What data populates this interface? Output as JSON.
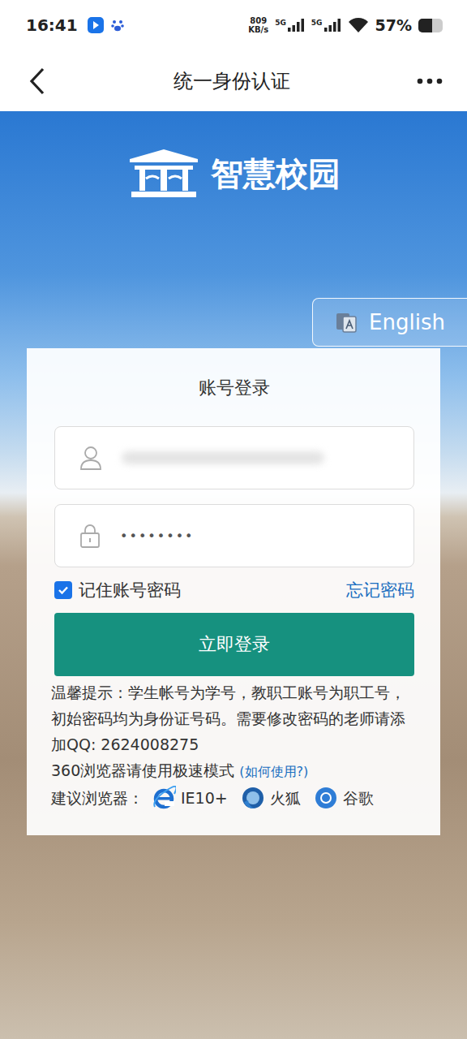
{
  "status_bar": {
    "time": "16:41",
    "speed": "809",
    "speed_unit": "KB/s",
    "network1": "5G",
    "network2": "5G",
    "battery": "57%",
    "battery_level": 0.57
  },
  "header": {
    "title": "统一身份认证"
  },
  "logo": {
    "text": "智慧校园"
  },
  "language_button": {
    "label": "English"
  },
  "login": {
    "title": "账号登录",
    "username": {
      "blurred": true
    },
    "password": {
      "value": "••••••••"
    },
    "remember": {
      "label": "记住账号密码",
      "checked": true
    },
    "forgot": "忘记密码",
    "submit": "立即登录"
  },
  "tips": {
    "text": "温馨提示：学生帐号为学号，教职工账号为职工号，初始密码均为身份证号码。需要修改密码的老师请添加QQ: 2624008275",
    "line2": "360浏览器请使用极速模式",
    "help_link": "(如何使用?)",
    "browsers_label": "建议浏览器：",
    "browsers": [
      {
        "name": "IE10+",
        "kind": "ie"
      },
      {
        "name": "火狐",
        "kind": "firefox"
      },
      {
        "name": "谷歌",
        "kind": "chrome"
      }
    ]
  }
}
